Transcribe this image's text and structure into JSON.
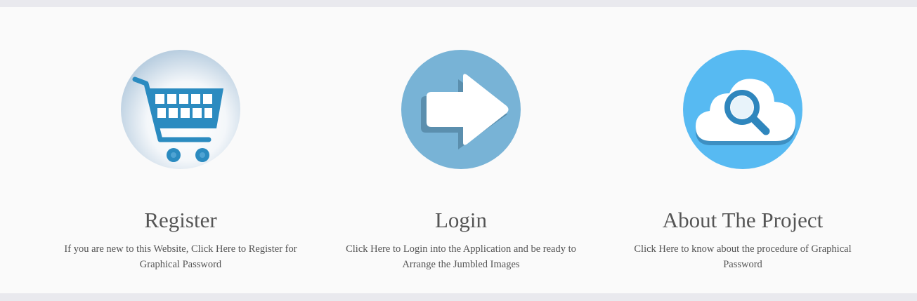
{
  "features": [
    {
      "title": "Register",
      "description": "If you are new to this Website, Click Here to Register for Graphical Password",
      "icon": "shopping-cart-icon",
      "icon_bg": "#dce6ef",
      "icon_color": "#2b8bc0"
    },
    {
      "title": "Login",
      "description": "Click Here to Login into the Application and be ready to Arrange the Jumbled Images",
      "icon": "arrow-right-icon",
      "icon_bg": "#78b3d6",
      "icon_color": "#ffffff"
    },
    {
      "title": "About The Project",
      "description": "Click Here to know about the procedure of Graphical Password",
      "icon": "cloud-search-icon",
      "icon_bg": "#57baf2",
      "icon_color": "#ffffff"
    }
  ],
  "colors": {
    "page_bg": "#e9e9ee",
    "panel_bg": "#fafafa",
    "text": "#555555"
  }
}
